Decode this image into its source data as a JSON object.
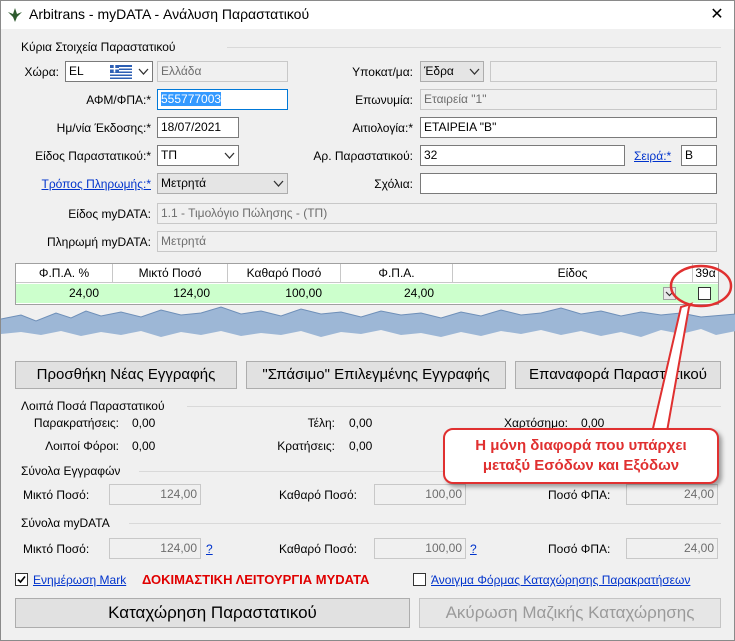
{
  "window": {
    "title": "Arbitrans - myDATA - Ανάλυση Παραστατικού",
    "close_glyph": "✕"
  },
  "main_info": {
    "group_title": "Κύρια Στοιχεία Παραστατικού",
    "country_label": "Χώρα:",
    "country_code": "EL",
    "country_name": "Ελλάδα",
    "afm_label": "ΑΦΜ/ΦΠΑ:*",
    "afm_value": "555777003",
    "date_label": "Ημ/νία Έκδοσης:*",
    "date_value": "18/07/2021",
    "doc_type_label": "Είδος Παραστατικού:*",
    "doc_type_value": "ΤΠ",
    "payment_method_label": "Τρόπος Πληρωμής:*",
    "payment_method_value": "Μετρητά",
    "branch_label": "Υποκατ/μα:",
    "branch_value": "Έδρα",
    "branch_extra": "",
    "name_label": "Επωνυμία:",
    "name_value": "Εταιρεία \"1\"",
    "reason_label": "Αιτιολογία:*",
    "reason_value": "ΕΤΑΙΡΕΙΑ \"Β\"",
    "doc_number_label": "Αρ. Παραστατικού:",
    "doc_number_value": "32",
    "series_label": "Σειρά:*",
    "series_value": "Β",
    "comments_label": "Σχόλια:",
    "comments_value": "",
    "mydata_type_label": "Είδος myDATA:",
    "mydata_type_value": "1.1 - Τιμολόγιο Πώλησης - (ΤΠ)",
    "mydata_payment_label": "Πληρωμή myDATA:",
    "mydata_payment_value": "Μετρητά"
  },
  "grid": {
    "headers": [
      "Φ.Π.Α. %",
      "Μικτό Ποσό",
      "Καθαρό Ποσό",
      "Φ.Π.Α.",
      "Είδος",
      "39α"
    ],
    "row": {
      "vat_pct": "24,00",
      "gross": "124,00",
      "net": "100,00",
      "vat": "24,00",
      "kind": ""
    }
  },
  "buttons": {
    "add": "Προσθήκη Νέας Εγγραφής",
    "split": "\"Σπάσιμο\" Επιλεγμένης Εγγραφής",
    "restore": "Επαναφορά Παραστατικού",
    "save": "Καταχώρηση Παραστατικού",
    "cancel_bulk": "Ακύρωση Μαζικής Καταχώρησης"
  },
  "other_amounts": {
    "group_title": "Λοιπά Ποσά Παραστατικού",
    "withholdings_label": "Παρακρατήσεις:",
    "withholdings_value": "0,00",
    "fees_label": "Τέλη:",
    "fees_value": "0,00",
    "stamp_label": "Χαρτόσημο:",
    "stamp_value": "0,00",
    "other_taxes_label": "Λοιποί Φόροι:",
    "other_taxes_value": "0,00",
    "deductions_label": "Κρατήσεις:",
    "deductions_value": "0,00"
  },
  "entry_totals": {
    "group_title": "Σύνολα Εγγραφών",
    "gross_label": "Μικτό Ποσό:",
    "gross_value": "124,00",
    "net_label": "Καθαρό Ποσό:",
    "net_value": "100,00",
    "vat_label": "Ποσό ΦΠΑ:",
    "vat_value": "24,00"
  },
  "mydata_totals": {
    "group_title": "Σύνολα myDATA",
    "gross_label": "Μικτό Ποσό:",
    "gross_value": "124,00",
    "net_label": "Καθαρό Ποσό:",
    "net_value": "100,00",
    "vat_label": "Ποσό ΦΠΑ:",
    "vat_value": "24,00",
    "help": "?"
  },
  "footer": {
    "update_mark_label": "Ενημέρωση Mark",
    "test_mode_text": "ΔΟΚΙΜΑΣΤΙΚΗ ΛΕΙΤΟΥΡΓΙΑ MYDATA",
    "open_withholdings_label": "Άνοιγμα Φόρμας Καταχώρησης Παρακρατήσεων"
  },
  "callout": {
    "line1": "Η μόνη διαφορά που υπάρχει",
    "line2": "μεταξύ Εσόδων και Εξόδων"
  },
  "colors": {
    "callout_red": "#e03030",
    "row_green": "#ccffcc",
    "selection_blue": "#3399ff",
    "link_blue": "#0033cc"
  }
}
